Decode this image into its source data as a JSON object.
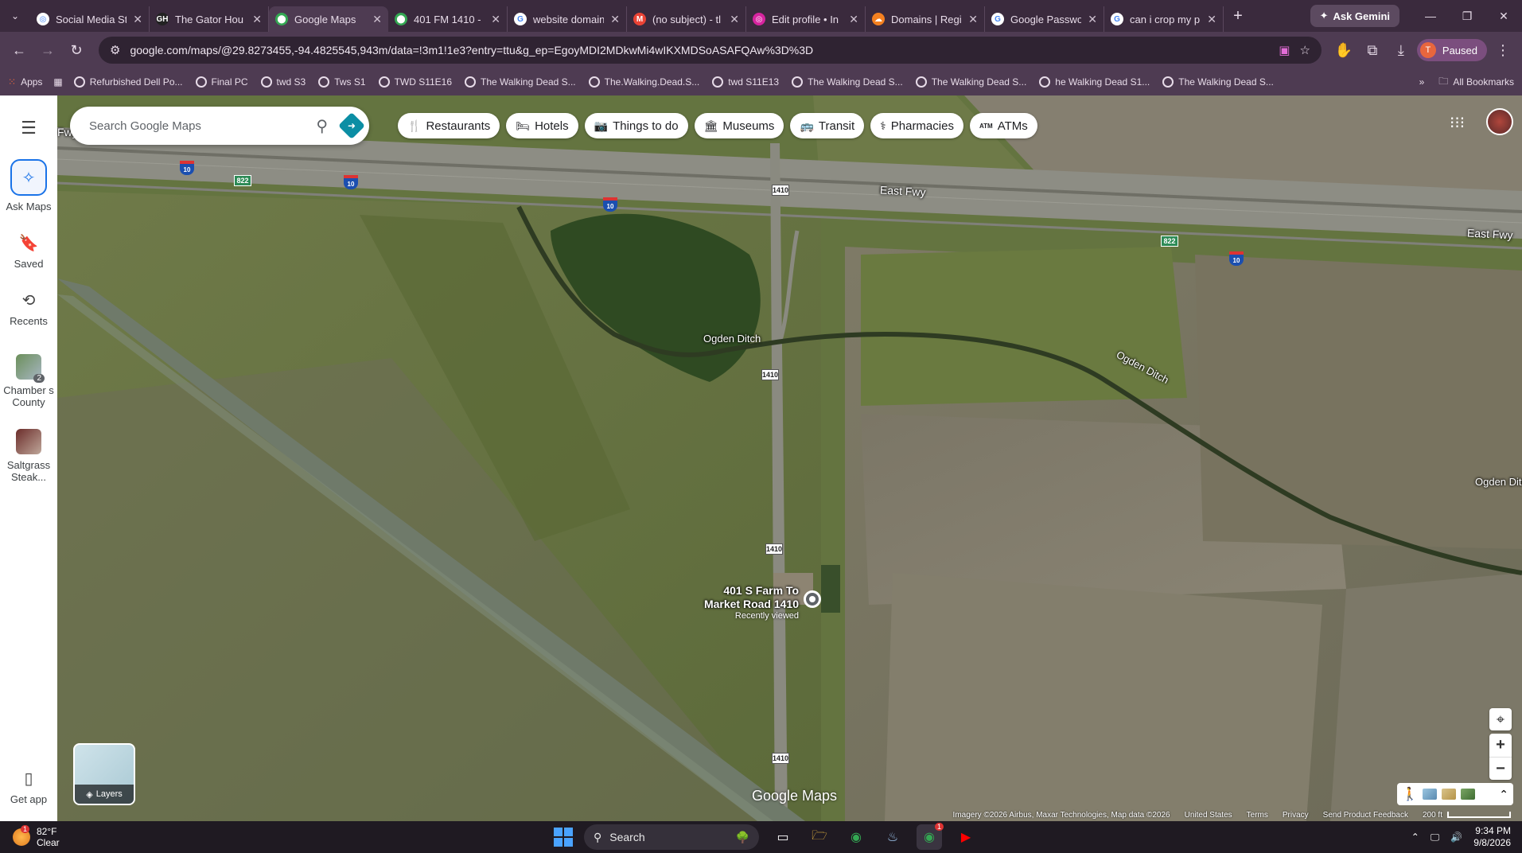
{
  "tabs": [
    {
      "title": "Social Media St",
      "fav_color": "#ffffff",
      "fav_text": "◎"
    },
    {
      "title": "The Gator Hou",
      "fav_color": "#222222",
      "fav_text": "GH"
    },
    {
      "title": "Google Maps",
      "fav_color": "#34a853",
      "fav_text": "⬤",
      "active": true
    },
    {
      "title": "401 FM 1410 -",
      "fav_color": "#34a853",
      "fav_text": "⬤"
    },
    {
      "title": "website domain",
      "fav_color": "#ffffff",
      "fav_text": "G"
    },
    {
      "title": "(no subject) - tl",
      "fav_color": "#ea4335",
      "fav_text": "M"
    },
    {
      "title": "Edit profile • In",
      "fav_color": "#d6249f",
      "fav_text": "◎"
    },
    {
      "title": "Domains | Regi",
      "fav_color": "#f38020",
      "fav_text": "☁"
    },
    {
      "title": "Google Passwo",
      "fav_color": "#ffffff",
      "fav_text": "G"
    },
    {
      "title": "can i crop my p",
      "fav_color": "#ffffff",
      "fav_text": "G"
    }
  ],
  "ask_gemini": "Ask Gemini",
  "url": "google.com/maps/@29.8273455,-94.4825545,943m/data=!3m1!1e3?entry=ttu&g_ep=EgoyMDI2MDkwMi4wIKXMDSoASAFQAw%3D%3D",
  "profile": {
    "initial": "T",
    "label": "Paused"
  },
  "bookmarks": {
    "apps": "Apps",
    "items": [
      "Refurbished Dell Po...",
      "Final PC",
      "twd S3",
      "Tws S1",
      "TWD S11E16",
      "The Walking Dead S...",
      "The.Walking.Dead.S...",
      "twd S11E13",
      "The Walking Dead S...",
      "The Walking Dead S...",
      "he Walking Dead S1...",
      "The Walking Dead S..."
    ],
    "all": "All Bookmarks"
  },
  "sidebar": {
    "ask_maps": "Ask Maps",
    "saved": "Saved",
    "recents": "Recents",
    "recent_places": [
      {
        "label": "Chamber s County",
        "badge": "2"
      },
      {
        "label": "Saltgrass Steak..."
      }
    ],
    "get_app": "Get app"
  },
  "search": {
    "placeholder": "Search Google Maps"
  },
  "chips": [
    {
      "label": "Restaurants",
      "icon": "fork-knife-icon",
      "glyph": "🍴"
    },
    {
      "label": "Hotels",
      "icon": "bed-icon",
      "glyph": "🛏"
    },
    {
      "label": "Things to do",
      "icon": "camera-icon",
      "glyph": "📷"
    },
    {
      "label": "Museums",
      "icon": "museum-icon",
      "glyph": "🏛"
    },
    {
      "label": "Transit",
      "icon": "bus-icon",
      "glyph": "🚌"
    },
    {
      "label": "Pharmacies",
      "icon": "pharmacy-icon",
      "glyph": "⚕"
    },
    {
      "label": "ATMs",
      "icon": "atm-icon",
      "glyph": "ATM"
    }
  ],
  "map_labels": {
    "east_fwy_left": "Fwy",
    "east_fwy_mid": "East Fwy",
    "east_fwy_right": "East Fwy",
    "ogden_1": "Ogden Ditch",
    "ogden_2": "Ogden Ditch",
    "ogden_3": "Ogden Ditc",
    "fm": "1410",
    "i10": "10",
    "r822": "822"
  },
  "pin": {
    "title": "401 S Farm To Market Road 1410",
    "subtitle": "Recently viewed"
  },
  "layers": "Layers",
  "logo": "Google Maps",
  "attribution": {
    "imagery": "Imagery ©2026 Airbus, Maxar Technologies, Map data ©2026",
    "country": "United States",
    "terms": "Terms",
    "privacy": "Privacy",
    "feedback": "Send Product Feedback",
    "scale": "200 ft"
  },
  "taskbar": {
    "temp": "82°F",
    "cond": "Clear",
    "weather_badge": "1",
    "search": "Search",
    "time": "9:34 PM",
    "date": "9/8/2026",
    "chrome_badge": "1"
  }
}
